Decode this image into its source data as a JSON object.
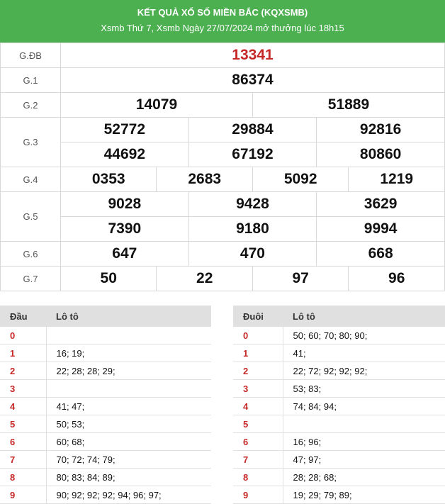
{
  "header": {
    "title": "KẾT QUẢ XỔ SỐ MIỀN BẮC (KQXSMB)",
    "subtitle": "Xsmb Thứ 7, Xsmb Ngày 27/07/2024 mở thưởng lúc 18h15"
  },
  "prizes": {
    "gdb": {
      "label": "G.ĐB",
      "nums": [
        "13341"
      ]
    },
    "g1": {
      "label": "G.1",
      "nums": [
        "86374"
      ]
    },
    "g2": {
      "label": "G.2",
      "nums": [
        "14079",
        "51889"
      ]
    },
    "g3": {
      "label": "G.3",
      "nums": [
        "52772",
        "29884",
        "92816",
        "44692",
        "67192",
        "80860"
      ]
    },
    "g4": {
      "label": "G.4",
      "nums": [
        "0353",
        "2683",
        "5092",
        "1219"
      ]
    },
    "g5": {
      "label": "G.5",
      "nums": [
        "9028",
        "9428",
        "3629",
        "7390",
        "9180",
        "9994"
      ]
    },
    "g6": {
      "label": "G.6",
      "nums": [
        "647",
        "470",
        "668"
      ]
    },
    "g7": {
      "label": "G.7",
      "nums": [
        "50",
        "22",
        "97",
        "96"
      ]
    }
  },
  "dau_table": {
    "col1": "Đầu",
    "col2": "Lô tô",
    "rows": [
      {
        "k": "0",
        "v": ""
      },
      {
        "k": "1",
        "v": "16; 19;"
      },
      {
        "k": "2",
        "v": "22; 28; 28; 29;"
      },
      {
        "k": "3",
        "v": ""
      },
      {
        "k": "4",
        "v": "41; 47;"
      },
      {
        "k": "5",
        "v": "50; 53;"
      },
      {
        "k": "6",
        "v": "60; 68;"
      },
      {
        "k": "7",
        "v": "70; 72; 74; 79;"
      },
      {
        "k": "8",
        "v": "80; 83; 84; 89;"
      },
      {
        "k": "9",
        "v": "90; 92; 92; 92; 94; 96; 97;"
      }
    ]
  },
  "duoi_table": {
    "col1": "Đuôi",
    "col2": "Lô tô",
    "rows": [
      {
        "k": "0",
        "v": "50; 60; 70; 80; 90;"
      },
      {
        "k": "1",
        "v": "41;"
      },
      {
        "k": "2",
        "v": "22; 72; 92; 92; 92;"
      },
      {
        "k": "3",
        "v": "53; 83;"
      },
      {
        "k": "4",
        "v": "74; 84; 94;"
      },
      {
        "k": "5",
        "v": ""
      },
      {
        "k": "6",
        "v": "16; 96;"
      },
      {
        "k": "7",
        "v": "47; 97;"
      },
      {
        "k": "8",
        "v": "28; 28; 68;"
      },
      {
        "k": "9",
        "v": "19; 29; 79; 89;"
      }
    ]
  },
  "colors": {
    "header_bg": "#4caf50",
    "special_prize": "#c62828",
    "key_digit": "#c62828"
  }
}
